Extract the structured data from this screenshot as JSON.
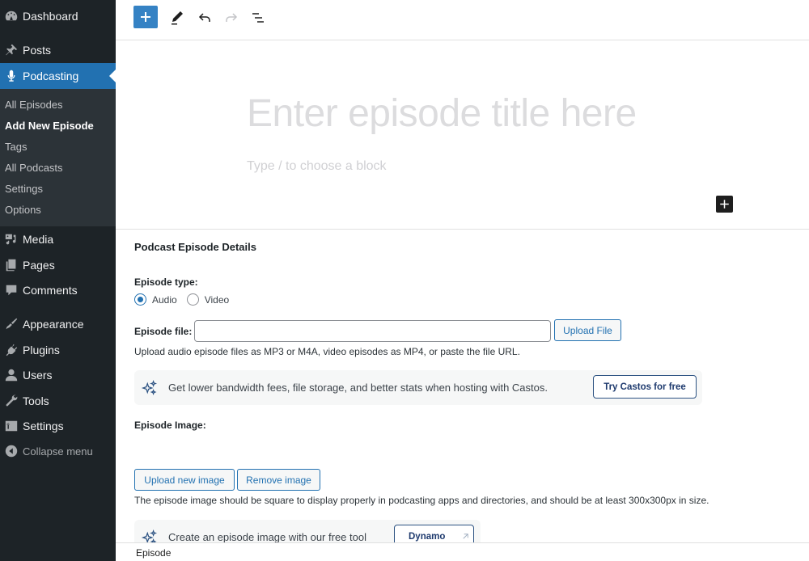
{
  "sidebar": {
    "top_items": [
      {
        "label": "Dashboard",
        "icon": "dashboard-icon"
      },
      {
        "label": "Posts",
        "icon": "pin-icon"
      },
      {
        "label": "Podcasting",
        "icon": "microphone-icon",
        "active": true
      }
    ],
    "submenu": [
      {
        "label": "All Episodes"
      },
      {
        "label": "Add New Episode",
        "current": true
      },
      {
        "label": "Tags"
      },
      {
        "label": "All Podcasts"
      },
      {
        "label": "Settings"
      },
      {
        "label": "Options"
      }
    ],
    "bottom_items": [
      {
        "label": "Media",
        "icon": "media-icon"
      },
      {
        "label": "Pages",
        "icon": "pages-icon"
      },
      {
        "label": "Comments",
        "icon": "comment-icon"
      },
      {
        "label": "Appearance",
        "icon": "paintbrush-icon"
      },
      {
        "label": "Plugins",
        "icon": "plugin-icon"
      },
      {
        "label": "Users",
        "icon": "user-icon"
      },
      {
        "label": "Tools",
        "icon": "wrench-icon"
      },
      {
        "label": "Settings",
        "icon": "settings-icon"
      },
      {
        "label": "Collapse menu",
        "icon": "collapse-icon"
      }
    ],
    "accent": "#2271b1"
  },
  "toolbar": {
    "add_block": "plus-icon",
    "tools": "pencil-icon",
    "undo": "undo-icon",
    "redo": "redo-icon",
    "document_overview": "list-view-icon"
  },
  "editor": {
    "title_placeholder": "Enter episode title here",
    "block_placeholder": "Type / to choose a block"
  },
  "metabox": {
    "title": "Podcast Episode Details",
    "episode_type_label": "Episode type:",
    "episode_type_options": [
      {
        "label": "Audio",
        "checked": true
      },
      {
        "label": "Video",
        "checked": false
      }
    ],
    "episode_file_label": "Episode file:",
    "episode_file_value": "",
    "upload_file_button": "Upload File",
    "episode_file_help": "Upload audio episode files as MP3 or M4A, video episodes as MP4, or paste the file URL.",
    "castos_promo": {
      "text": "Get lower bandwidth fees, file storage, and better stats when hosting with Castos.",
      "button": "Try Castos for free"
    },
    "episode_image_label": "Episode Image:",
    "upload_image_button": "Upload new image",
    "remove_image_button": "Remove image",
    "episode_image_help": "The episode image should be square to display properly in podcasting apps and directories, and should be at least 300x300px in size.",
    "dynamo_promo": {
      "text": "Create an episode image with our free tool",
      "button": "Dynamo"
    }
  },
  "footer": {
    "breadcrumb": "Episode"
  }
}
